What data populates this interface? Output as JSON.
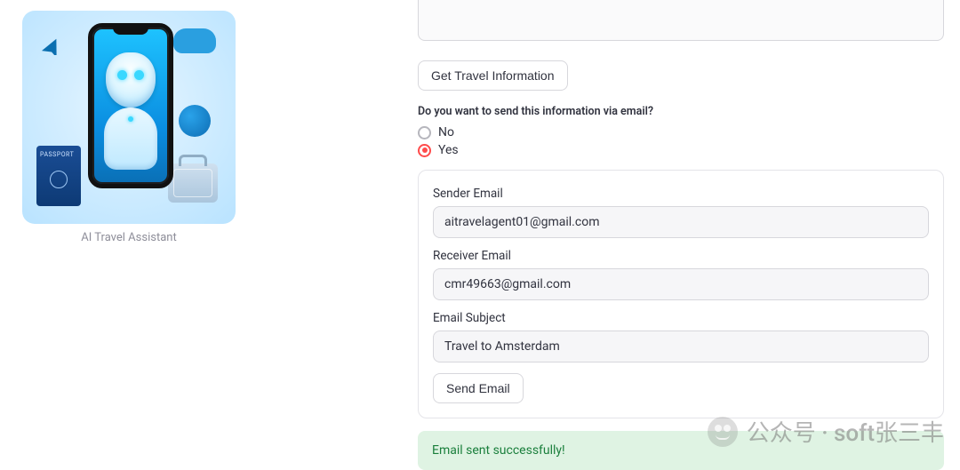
{
  "left": {
    "caption": "AI Travel Assistant",
    "passport_label": "PASSPORT"
  },
  "buttons": {
    "get_info": "Get Travel Information",
    "send_email": "Send Email"
  },
  "radio": {
    "question": "Do you want to send this information via email?",
    "options": [
      "No",
      "Yes"
    ],
    "selected": "Yes"
  },
  "form": {
    "sender": {
      "label": "Sender Email",
      "value": "aitravelagent01@gmail.com"
    },
    "receiver": {
      "label": "Receiver Email",
      "value": "cmr49663@gmail.com"
    },
    "subject": {
      "label": "Email Subject",
      "value": "Travel to Amsterdam"
    }
  },
  "alert": {
    "success": "Email sent successfully!"
  },
  "watermark": "公众号 · soft张三丰"
}
